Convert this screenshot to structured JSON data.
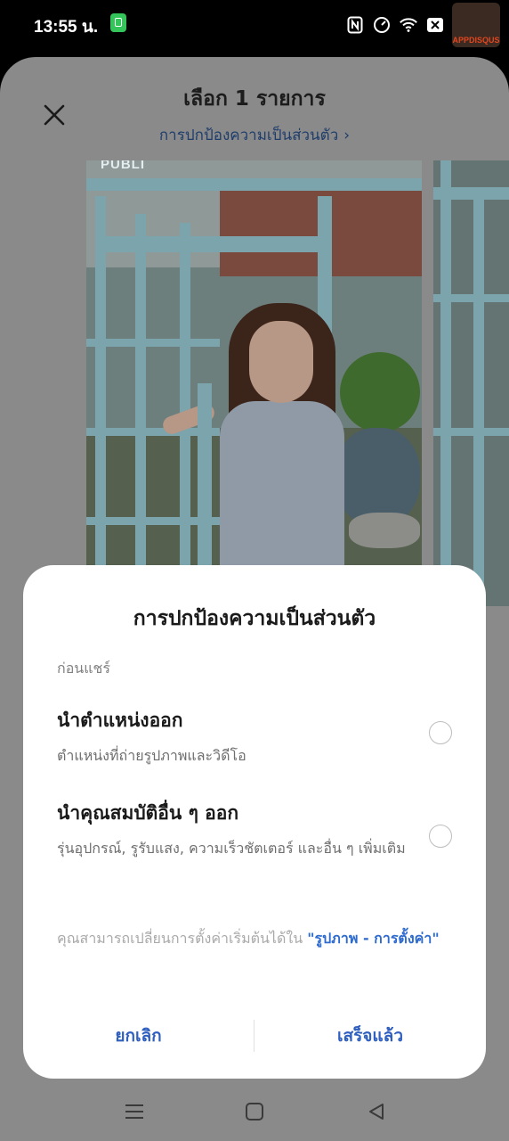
{
  "status_bar": {
    "time": "13:55 น.",
    "icons": [
      "app-notification-icon",
      "nfc-icon",
      "speed-icon",
      "wifi-icon",
      "close-box-icon",
      "battery-icon"
    ],
    "watermark_text": "APPDISQUS"
  },
  "header": {
    "title": "เลือก 1 รายการ",
    "privacy_link": "การปกป้องความเป็นส่วนตัว",
    "link_chevron": "›"
  },
  "photo_overlay_text": "PUBLI",
  "dialog": {
    "title": "การปกป้องความเป็นส่วนตัว",
    "section_label": "ก่อนแชร์",
    "options": [
      {
        "title": "นำตำแหน่งออก",
        "description": "ตำแหน่งที่ถ่ายรูปภาพและวิดีโอ",
        "selected": false
      },
      {
        "title": "นำคุณสมบัติอื่น ๆ ออก",
        "description": "รุ่นอุปกรณ์, รูรับแสง, ความเร็วชัตเตอร์ และอื่น ๆ เพิ่มเติม",
        "selected": false
      }
    ],
    "note_text": "คุณสามารถเปลี่ยนการตั้งค่าเริ่มต้นได้ใน ",
    "note_link": "\"รูปภาพ - การตั้งค่า\"",
    "cancel_label": "ยกเลิก",
    "done_label": "เสร็จแล้ว"
  },
  "colors": {
    "accent": "#2f5fbf",
    "link_blue": "#2e6bcf",
    "scrim": "#8a8a8a",
    "dialog_bg": "#ffffff"
  }
}
